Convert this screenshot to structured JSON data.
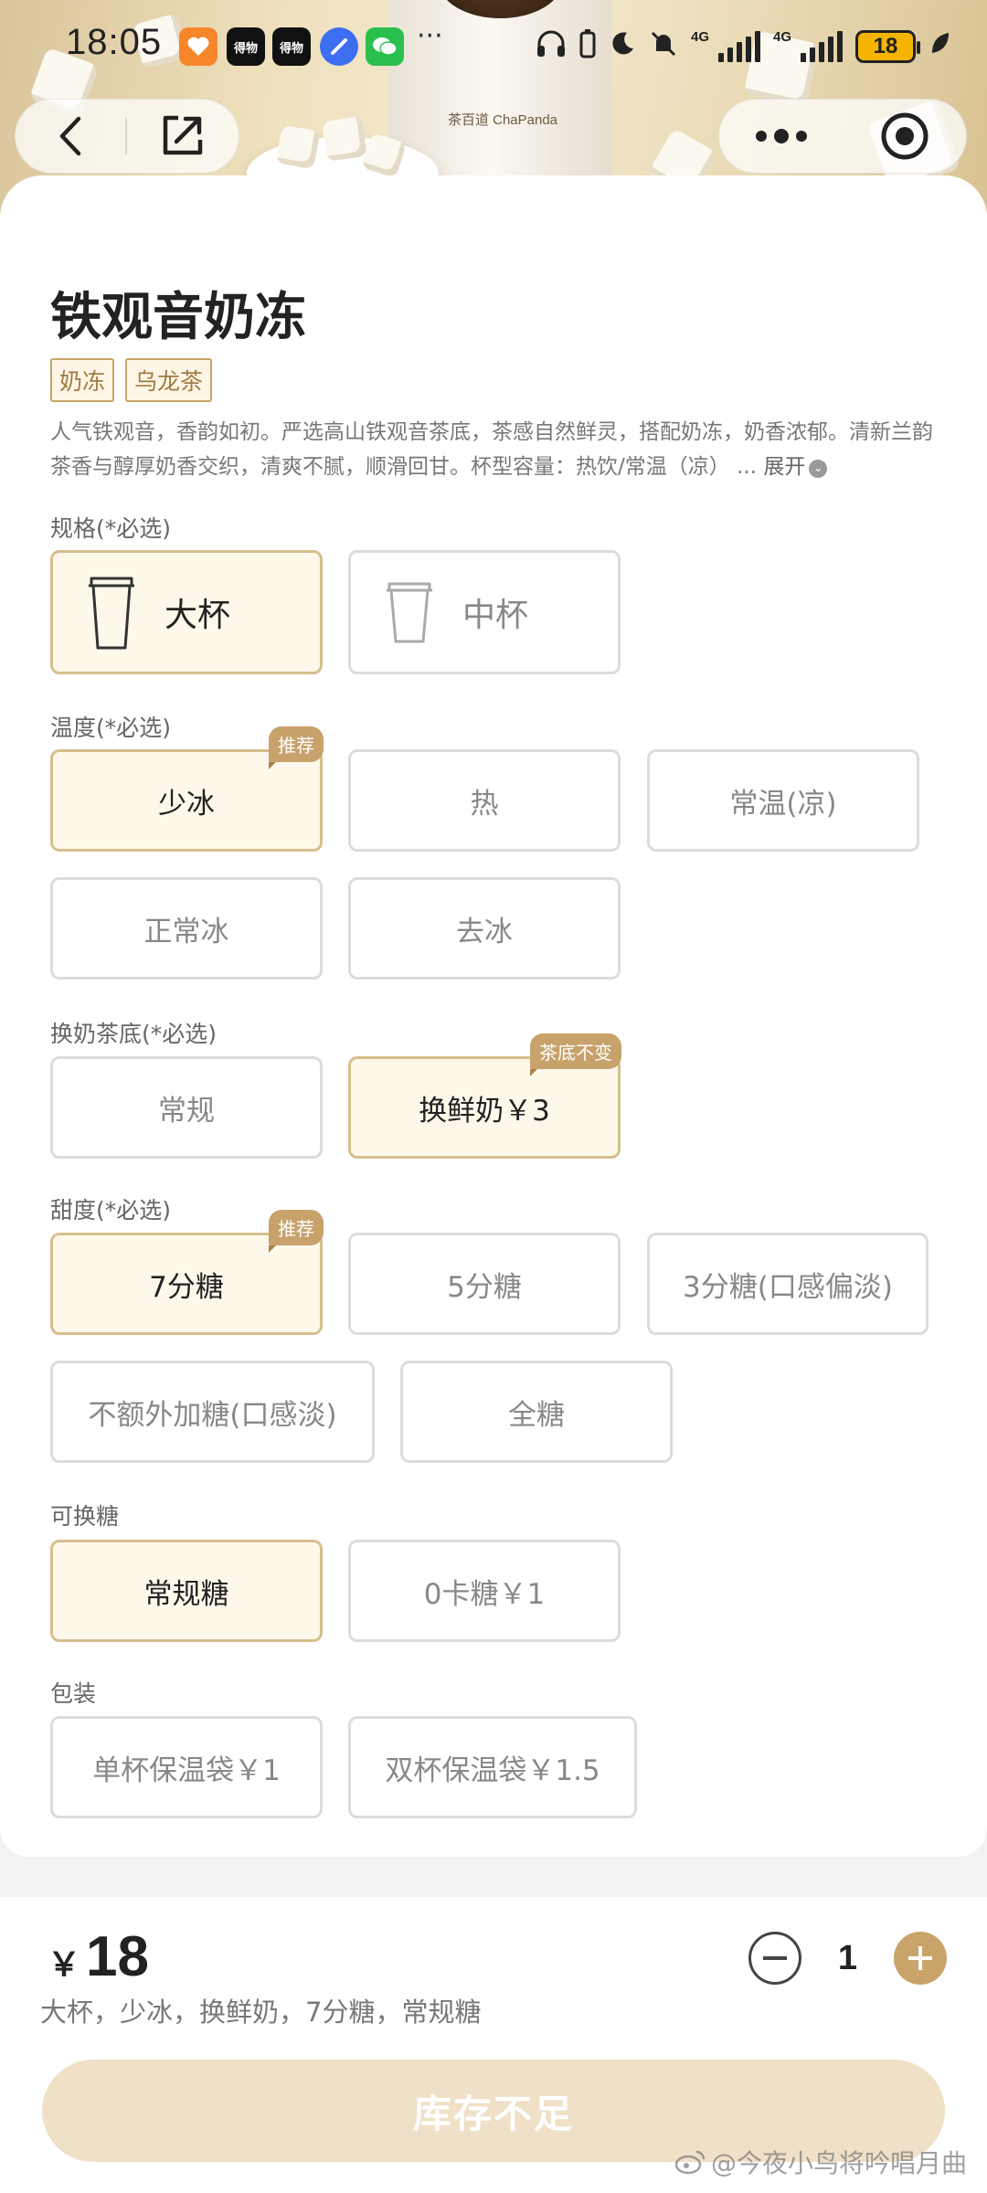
{
  "status_bar": {
    "time": "18:05",
    "app_icon_1": "heart-app-icon",
    "app_icon_2_label": "得物",
    "app_icon_3_label": "得物",
    "more": "···",
    "network_1": "4G",
    "network_2": "4G",
    "battery": "18"
  },
  "banner": {
    "cup_brand": "茶百道 ChaPanda"
  },
  "product": {
    "name": "铁观音奶冻",
    "tags": [
      "奶冻",
      "乌龙茶"
    ],
    "description": "人气铁观音，香韵如初。严选高山铁观音茶底，茶感自然鲜灵，搭配奶冻，奶香浓郁。清新兰韵茶香与醇厚奶香交织，清爽不腻，顺滑回甘。杯型容量：热饮/常温（凉） ...",
    "expand_label": "展开"
  },
  "sections": {
    "size": {
      "label": "规格(*必选)",
      "options": [
        "大杯",
        "中杯"
      ]
    },
    "temperature": {
      "label": "温度(*必选)",
      "options": [
        "少冰",
        "热",
        "常温(凉)",
        "正常冰",
        "去冰"
      ],
      "badge": "推荐"
    },
    "milk_base": {
      "label": "换奶茶底(*必选)",
      "options": [
        "常规",
        "换鲜奶￥3"
      ],
      "badge": "茶底不变"
    },
    "sweetness": {
      "label": "甜度(*必选)",
      "options": [
        "7分糖",
        "5分糖",
        "3分糖(口感偏淡)",
        "不额外加糖(口感淡)",
        "全糖"
      ],
      "badge": "推荐"
    },
    "sugar_type": {
      "label": "可换糖",
      "options": [
        "常规糖",
        "0卡糖￥1"
      ]
    },
    "packaging": {
      "label": "包装",
      "options": [
        "单杯保温袋￥1",
        "双杯保温袋￥1.5"
      ]
    }
  },
  "order": {
    "currency": "￥",
    "price": "18",
    "summary": "大杯，少冰，换鲜奶，7分糖，常规糖",
    "quantity": "1",
    "minus": "−",
    "plus": "+",
    "submit_label": "库存不足"
  },
  "watermark": "@今夜小鸟将吟唱月曲",
  "colors": {
    "accent": "#c9a46a",
    "selected_bg": "#fdf8ea",
    "selected_border": "#d6bf8d",
    "disabled_button": "#efe0c7"
  }
}
